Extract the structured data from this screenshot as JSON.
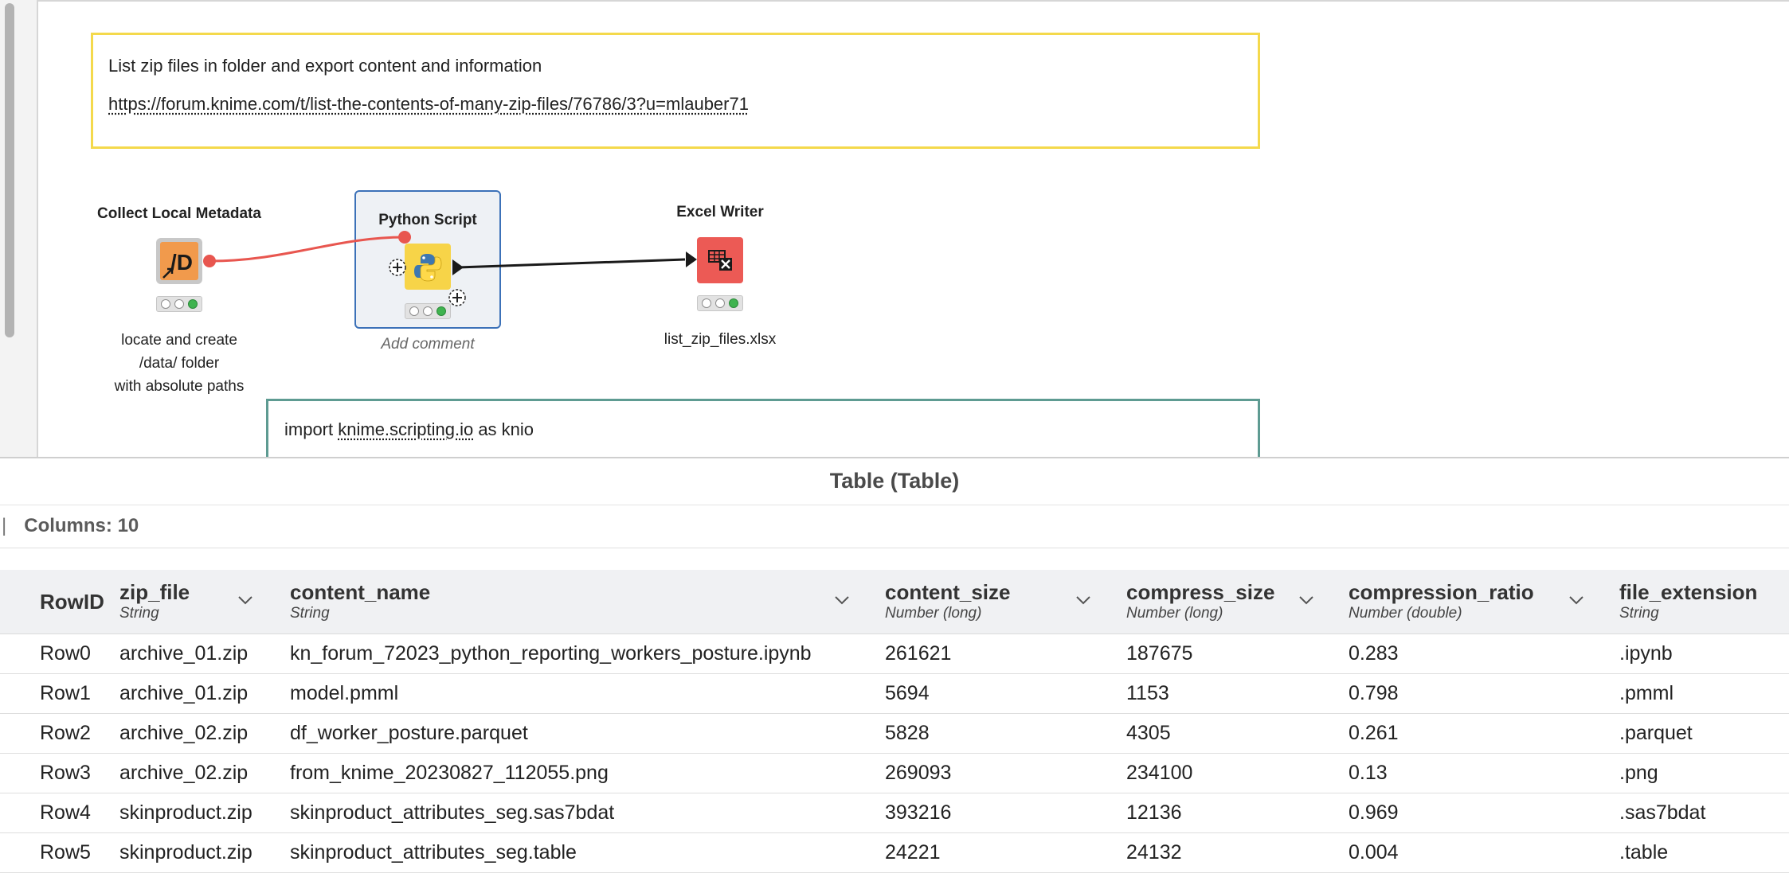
{
  "workflow": {
    "annotation_top": {
      "title": "List zip files in folder and export content and information",
      "link": "https://forum.knime.com/t/list-the-contents-of-many-zip-files/76786/3?u=mlauber71"
    },
    "annotation_bottom": {
      "prefix": "import ",
      "module": "knime.scripting.io",
      "suffix": " as knio"
    },
    "nodes": [
      {
        "title": "Collect Local Metadata",
        "label_lines": [
          "locate and create",
          "/data/ folder",
          "with absolute paths"
        ],
        "icon": "metanode-data-icon",
        "color": "#f19a4c"
      },
      {
        "title": "Python Script",
        "label": "Add comment",
        "icon": "python-icon",
        "color": "#f7d448"
      },
      {
        "title": "Excel Writer",
        "label": "list_zip_files.xlsx",
        "icon": "excel-writer-icon",
        "color": "#ec5a55"
      }
    ],
    "connection_colors": {
      "flow_variable": "#e8564f",
      "data": "#1a1a1a"
    }
  },
  "table_view": {
    "title": "Table (Table)",
    "columns_info": "Columns: 10",
    "rowid_header": "RowID",
    "columns": [
      {
        "name": "zip_file",
        "type": "String"
      },
      {
        "name": "content_name",
        "type": "String"
      },
      {
        "name": "content_size",
        "type": "Number (long)"
      },
      {
        "name": "compress_size",
        "type": "Number (long)"
      },
      {
        "name": "compression_ratio",
        "type": "Number (double)"
      },
      {
        "name": "file_extension",
        "type": "String"
      }
    ],
    "rows": [
      {
        "id": "Row0",
        "cells": [
          "archive_01.zip",
          "kn_forum_72023_python_reporting_workers_posture.ipynb",
          "261621",
          "187675",
          "0.283",
          ".ipynb"
        ]
      },
      {
        "id": "Row1",
        "cells": [
          "archive_01.zip",
          "model.pmml",
          "5694",
          "1153",
          "0.798",
          ".pmml"
        ]
      },
      {
        "id": "Row2",
        "cells": [
          "archive_02.zip",
          "df_worker_posture.parquet",
          "5828",
          "4305",
          "0.261",
          ".parquet"
        ]
      },
      {
        "id": "Row3",
        "cells": [
          "archive_02.zip",
          "from_knime_20230827_112055.png",
          "269093",
          "234100",
          "0.13",
          ".png"
        ]
      },
      {
        "id": "Row4",
        "cells": [
          "skinproduct.zip",
          "skinproduct_attributes_seg.sas7bdat",
          "393216",
          "12136",
          "0.969",
          ".sas7bdat"
        ]
      },
      {
        "id": "Row5",
        "cells": [
          "skinproduct.zip",
          "skinproduct_attributes_seg.table",
          "24221",
          "24132",
          "0.004",
          ".table"
        ]
      }
    ]
  }
}
